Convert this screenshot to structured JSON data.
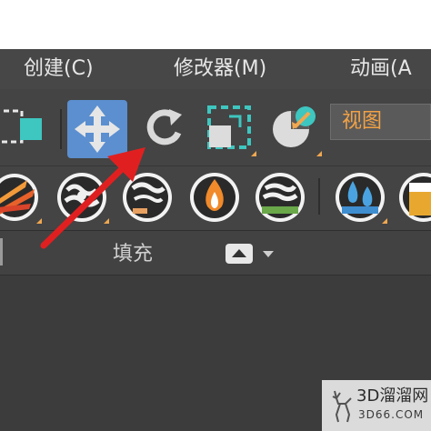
{
  "menu": {
    "items": [
      {
        "label": "创建(C)"
      },
      {
        "label": "修改器(M)"
      },
      {
        "label": "动画(A"
      }
    ]
  },
  "toolbar": {
    "view_dropdown": "视图"
  },
  "ribbon": {
    "fill_label": "填充"
  },
  "watermark": {
    "main": "3D溜溜网",
    "sub": "3D66.COM"
  },
  "icons": {
    "select_region": "select-region-icon",
    "move": "move-icon",
    "rotate": "rotate-icon",
    "scale": "scale-icon",
    "placement": "placement-icon",
    "fire_effect": "fire-effect-icon",
    "smoke1": "smoke-icon",
    "smoke2": "smoke-icon",
    "flame": "flame-icon",
    "mist": "mist-icon",
    "water": "water-icon",
    "beer": "liquid-icon"
  },
  "colors": {
    "accent_orange": "#f2a245",
    "move_active": "#5b8fd0",
    "arrow_red": "#e02020"
  }
}
